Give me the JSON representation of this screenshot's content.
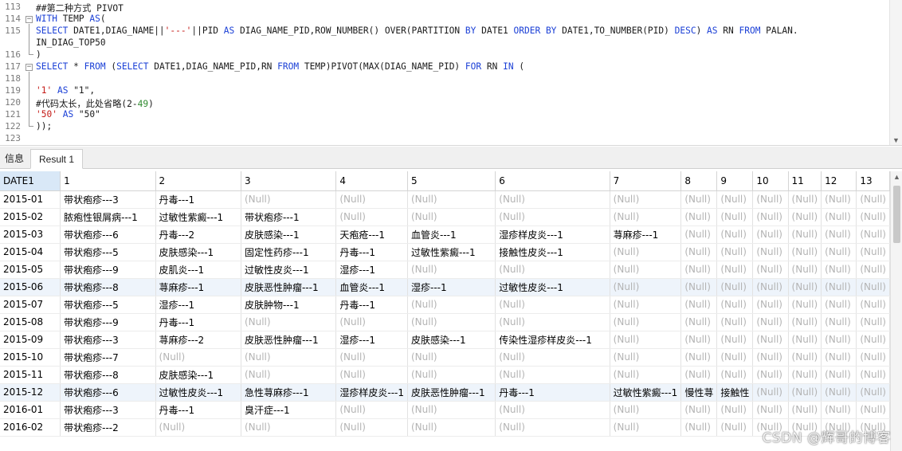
{
  "editor": {
    "line_numbers": [
      "113",
      "114",
      "115",
      "",
      "116",
      "117",
      "118",
      "119",
      "120",
      "121",
      "122",
      "123"
    ],
    "lines": [
      [
        {
          "t": "##第二种方式 PIVOT",
          "c": ""
        }
      ],
      [
        {
          "t": "WITH",
          "c": "kw"
        },
        {
          "t": " TEMP ",
          "c": ""
        },
        {
          "t": "AS",
          "c": "kw"
        },
        {
          "t": "(",
          "c": ""
        }
      ],
      [
        {
          "t": "SELECT",
          "c": "kw"
        },
        {
          "t": " DATE1,DIAG_NAME||",
          "c": ""
        },
        {
          "t": "'---'",
          "c": "str"
        },
        {
          "t": "||PID ",
          "c": ""
        },
        {
          "t": "AS",
          "c": "kw"
        },
        {
          "t": " DIAG_NAME_PID,ROW_NUMBER() OVER(PARTITION ",
          "c": ""
        },
        {
          "t": "BY",
          "c": "kw"
        },
        {
          "t": " DATE1 ",
          "c": ""
        },
        {
          "t": "ORDER BY",
          "c": "kw"
        },
        {
          "t": " DATE1,TO_NUMBER(PID) ",
          "c": ""
        },
        {
          "t": "DESC",
          "c": "kw"
        },
        {
          "t": ") ",
          "c": ""
        },
        {
          "t": "AS",
          "c": "kw"
        },
        {
          "t": " RN ",
          "c": ""
        },
        {
          "t": "FROM",
          "c": "kw"
        },
        {
          "t": " PALAN.",
          "c": ""
        }
      ],
      [
        {
          "t": "IN_DIAG_TOP50",
          "c": ""
        }
      ],
      [
        {
          "t": ")",
          "c": ""
        }
      ],
      [
        {
          "t": "SELECT",
          "c": "kw"
        },
        {
          "t": " * ",
          "c": ""
        },
        {
          "t": "FROM",
          "c": "kw"
        },
        {
          "t": " (",
          "c": ""
        },
        {
          "t": "SELECT",
          "c": "kw"
        },
        {
          "t": " DATE1,DIAG_NAME_PID,RN ",
          "c": ""
        },
        {
          "t": "FROM",
          "c": "kw"
        },
        {
          "t": " TEMP)PIVOT(MAX(DIAG_NAME_PID) ",
          "c": ""
        },
        {
          "t": "FOR",
          "c": "kw"
        },
        {
          "t": " RN ",
          "c": ""
        },
        {
          "t": "IN",
          "c": "kw"
        },
        {
          "t": " (",
          "c": ""
        }
      ],
      [
        {
          "t": "",
          "c": ""
        }
      ],
      [
        {
          "t": "'1'",
          "c": "str"
        },
        {
          "t": " ",
          "c": ""
        },
        {
          "t": "AS",
          "c": "kw"
        },
        {
          "t": " \"1\",",
          "c": ""
        }
      ],
      [
        {
          "t": "#代码太长，此处省略(2-",
          "c": ""
        },
        {
          "t": "49",
          "c": "cmt"
        },
        {
          "t": ")",
          "c": ""
        }
      ],
      [
        {
          "t": "'50'",
          "c": "str"
        },
        {
          "t": " ",
          "c": ""
        },
        {
          "t": "AS",
          "c": "kw"
        },
        {
          "t": " \"50\"",
          "c": ""
        }
      ],
      [
        {
          "t": "));",
          "c": ""
        }
      ],
      [
        {
          "t": "",
          "c": ""
        }
      ]
    ]
  },
  "tabs": {
    "info": "信息",
    "result": "Result 1"
  },
  "grid": {
    "null_text": "(Null)",
    "columns": [
      "DATE1",
      "1",
      "2",
      "3",
      "4",
      "5",
      "6",
      "7",
      "8",
      "9",
      "10",
      "11",
      "12",
      "13"
    ],
    "highlighted_rows": [
      5,
      11
    ],
    "rows": [
      [
        "2015-01",
        "带状疱疹---3",
        "丹毒---1",
        null,
        null,
        null,
        null,
        null,
        null,
        null,
        null,
        null,
        null,
        null
      ],
      [
        "2015-02",
        "脓疱性银屑病---1",
        "过敏性紫癜---1",
        "带状疱疹---1",
        null,
        null,
        null,
        null,
        null,
        null,
        null,
        null,
        null,
        null
      ],
      [
        "2015-03",
        "带状疱疹---6",
        "丹毒---2",
        "皮肤感染---1",
        "天疱疮---1",
        "血管炎---1",
        "湿疹样皮炎---1",
        "荨麻疹---1",
        null,
        null,
        null,
        null,
        null,
        null
      ],
      [
        "2015-04",
        "带状疱疹---5",
        "皮肤感染---1",
        "固定性药疹---1",
        "丹毒---1",
        "过敏性紫癜---1",
        "接触性皮炎---1",
        null,
        null,
        null,
        null,
        null,
        null,
        null
      ],
      [
        "2015-05",
        "带状疱疹---9",
        "皮肌炎---1",
        "过敏性皮炎---1",
        "湿疹---1",
        null,
        null,
        null,
        null,
        null,
        null,
        null,
        null,
        null
      ],
      [
        "2015-06",
        "带状疱疹---8",
        "荨麻疹---1",
        "皮肤恶性肿瘤---1",
        "血管炎---1",
        "湿疹---1",
        "过敏性皮炎---1",
        null,
        null,
        null,
        null,
        null,
        null,
        null
      ],
      [
        "2015-07",
        "带状疱疹---5",
        "湿疹---1",
        "皮肤肿物---1",
        "丹毒---1",
        null,
        null,
        null,
        null,
        null,
        null,
        null,
        null,
        null
      ],
      [
        "2015-08",
        "带状疱疹---9",
        "丹毒---1",
        null,
        null,
        null,
        null,
        null,
        null,
        null,
        null,
        null,
        null,
        null
      ],
      [
        "2015-09",
        "带状疱疹---3",
        "荨麻疹---2",
        "皮肤恶性肿瘤---1",
        "湿疹---1",
        "皮肤感染---1",
        "传染性湿疹样皮炎---1",
        null,
        null,
        null,
        null,
        null,
        null,
        null
      ],
      [
        "2015-10",
        "带状疱疹---7",
        null,
        null,
        null,
        null,
        null,
        null,
        null,
        null,
        null,
        null,
        null,
        null
      ],
      [
        "2015-11",
        "带状疱疹---8",
        "皮肤感染---1",
        null,
        null,
        null,
        null,
        null,
        null,
        null,
        null,
        null,
        null,
        null
      ],
      [
        "2015-12",
        "带状疱疹---6",
        "过敏性皮炎---1",
        "急性荨麻疹---1",
        "湿疹样皮炎---1",
        "皮肤恶性肿瘤---1",
        "丹毒---1",
        "过敏性紫癜---1",
        "慢性荨",
        "接触性",
        null,
        null,
        null,
        null
      ],
      [
        "2016-01",
        "带状疱疹---3",
        "丹毒---1",
        "臭汗症---1",
        null,
        null,
        null,
        null,
        null,
        null,
        null,
        null,
        null,
        null
      ],
      [
        "2016-02",
        "带状疱疹---2",
        null,
        null,
        null,
        null,
        null,
        null,
        null,
        null,
        null,
        null,
        null,
        null
      ]
    ]
  },
  "watermark": "CSDN @辉哥的博客"
}
